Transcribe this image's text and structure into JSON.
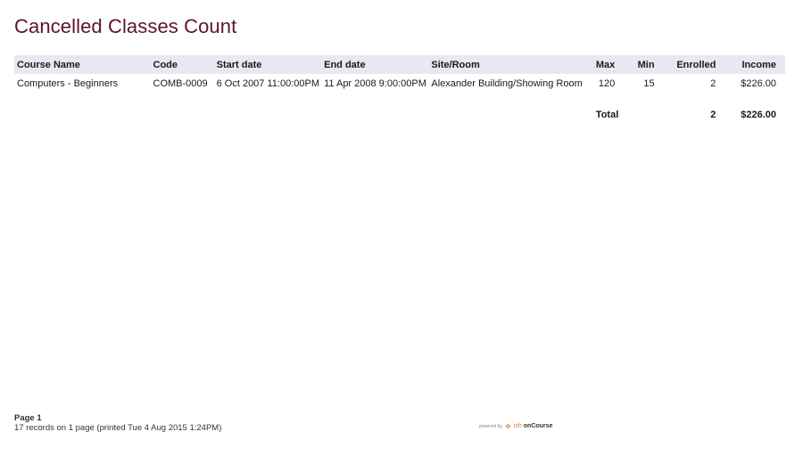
{
  "report": {
    "title": "Cancelled Classes Count"
  },
  "table": {
    "headers": {
      "course_name": "Course Name",
      "code": "Code",
      "start_date": "Start date",
      "end_date": "End date",
      "site_room": "Site/Room",
      "max": "Max",
      "min": "Min",
      "enrolled": "Enrolled",
      "income": "Income"
    },
    "rows": [
      {
        "course_name": "Computers - Beginners",
        "code": "COMB-0009",
        "start_date": "6 Oct 2007 11:00:00PM",
        "end_date": "11 Apr 2008 9:00:00PM",
        "site_room": "Alexander Building/Showing Room",
        "max": "120",
        "min": "15",
        "enrolled": "2",
        "income": "$226.00"
      }
    ],
    "total": {
      "label": "Total",
      "enrolled": "2",
      "income": "$226.00"
    }
  },
  "footer": {
    "page_label": "Page 1",
    "records_text": "17 records on 1 page (printed Tue 4 Aug 2015 1:24PM)",
    "powered_by": "powered by",
    "brand_ish": "ish",
    "brand_name": "onCourse",
    "logo_icon": "ish-logo-icon",
    "accent_color": "#5a1432"
  }
}
